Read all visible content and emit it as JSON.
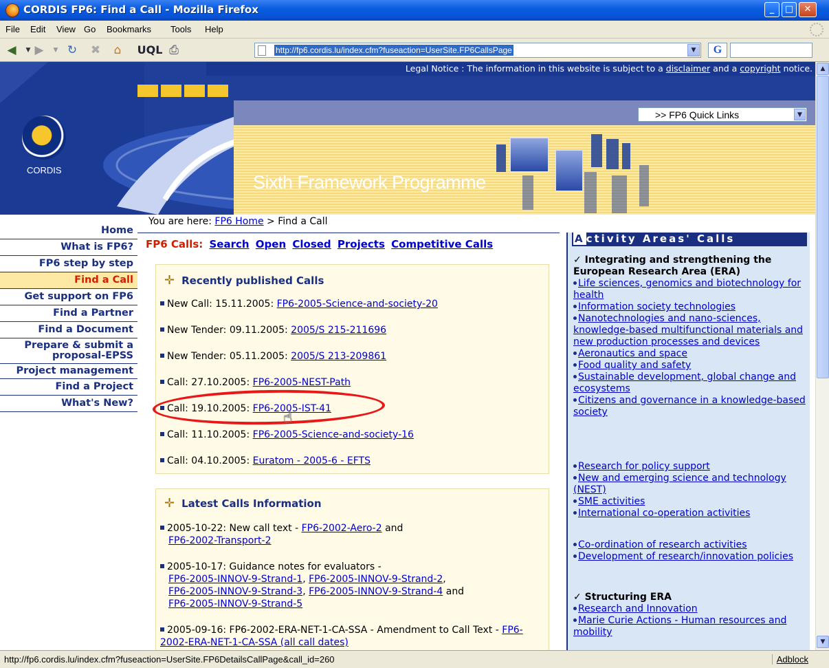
{
  "window": {
    "title": "CORDIS FP6: Find a Call - Mozilla Firefox"
  },
  "menu": [
    "File",
    "Edit",
    "View",
    "Go",
    "Bookmarks",
    "Tools",
    "Help"
  ],
  "toolbar": {
    "uql_label": "UQL",
    "url": "http://fp6.cordis.lu/index.cfm?fuseaction=UserSite.FP6CallsPage",
    "search_engine_glyph": "G"
  },
  "header": {
    "legal_prefix": "Legal Notice : The information in this website is subject to a",
    "legal_disclaimer": "disclaimer",
    "legal_and": "and a",
    "legal_copyright": "copyright",
    "legal_suffix": "notice.",
    "quick_links": ">> FP6 Quick Links",
    "logo_text": "CORDIS",
    "programme": "Sixth Framework Programme",
    "accent_color": "#f3c72d",
    "brand_color": "#1f3f99"
  },
  "nav": [
    {
      "label": "Home",
      "active": false
    },
    {
      "label": "What is FP6?",
      "active": false
    },
    {
      "label": "FP6 step by step",
      "active": false
    },
    {
      "label": "Find a Call",
      "active": true
    },
    {
      "label": "Get support on FP6",
      "active": false
    },
    {
      "label": "Find a Partner",
      "active": false
    },
    {
      "label": "Find a Document",
      "active": false
    },
    {
      "label": "Prepare & submit a proposal-EPSS",
      "active": false
    },
    {
      "label": "Project management",
      "active": false
    },
    {
      "label": "Find a Project",
      "active": false
    },
    {
      "label": "What's New?",
      "active": false
    }
  ],
  "breadcrumb": {
    "prefix": "You are here:",
    "home": "FP6 Home",
    "sep": ">",
    "current": "Find a Call"
  },
  "calls_title": {
    "label": "FP6 Calls:",
    "links": [
      "Search",
      "Open",
      "Closed",
      "Projects",
      "Competitive Calls"
    ]
  },
  "recent": {
    "title": "Recently published Calls",
    "items": [
      {
        "prefix": "New Call: 15.11.2005:",
        "link": "FP6-2005-Science-and-society-20"
      },
      {
        "prefix": "New Tender: 09.11.2005:",
        "link": "2005/S 215-211696"
      },
      {
        "prefix": "New Tender: 05.11.2005:",
        "link": "2005/S 213-209861"
      },
      {
        "prefix": "Call: 27.10.2005:",
        "link": "FP6-2005-NEST-Path"
      },
      {
        "prefix": "Call: 19.10.2005:",
        "link": "FP6-2005-IST-41"
      },
      {
        "prefix": "Call: 11.10.2005:",
        "link": "FP6-2005-Science-and-society-16"
      },
      {
        "prefix": "Call: 04.10.2005:",
        "link": "Euratom - 2005-6 - EFTS"
      }
    ]
  },
  "latest": {
    "title": "Latest Calls Information",
    "item1": {
      "text": "2005-10-22: New call text -",
      "link1": "FP6-2002-Aero-2",
      "and": "and",
      "link2": "FP6-2002-Transport-2"
    },
    "item2": {
      "text": "2005-10-17: Guidance notes for evaluators -",
      "l1": "FP6-2005-INNOV-9-Strand-1",
      "l2": "FP6-2005-INNOV-9-Strand-2",
      "l3": "FP6-2005-INNOV-9-Strand-3",
      "l4": "FP6-2005-INNOV-9-Strand-4",
      "and": "and",
      "l5": "FP6-2005-INNOV-9-Strand-5"
    },
    "item3": {
      "text": "2005-09-16: FP6-2002-ERA-NET-1-CA-SSA - Amendment to Call Text -",
      "link": "FP6-2002-ERA-NET-1-CA-SSA (all call dates)"
    }
  },
  "activity": {
    "head_first": "A",
    "head_rest": "ctivity Areas' Calls",
    "sec1_title": "Integrating and strengthening the European Research Area (ERA)",
    "sec1_items": [
      "Life sciences, genomics and biotechnology for health",
      "Information society technologies",
      "Nanotechnologies and nano-sciences, knowledge-based multifunctional materials and new production processes and devices",
      "Aeronautics and space",
      "Food quality and safety",
      "Sustainable development, global change and ecosystems",
      "Citizens and governance in a knowledge-based society"
    ],
    "sec2_items": [
      "Research for policy support",
      "New and emerging science and technology (NEST)",
      "SME activities",
      "International co-operation activities"
    ],
    "sec3_items": [
      "Co-ordination of research activities",
      "Development of research/innovation policies"
    ],
    "sec4_title": "Structuring ERA",
    "sec4_items": [
      "Research and Innovation",
      "Marie Curie Actions - Human resources and mobility"
    ]
  },
  "status": {
    "url": "http://fp6.cordis.lu/index.cfm?fuseaction=UserSite.FP6DetailsCallPage&call_id=260",
    "adblock": "Adblock"
  }
}
